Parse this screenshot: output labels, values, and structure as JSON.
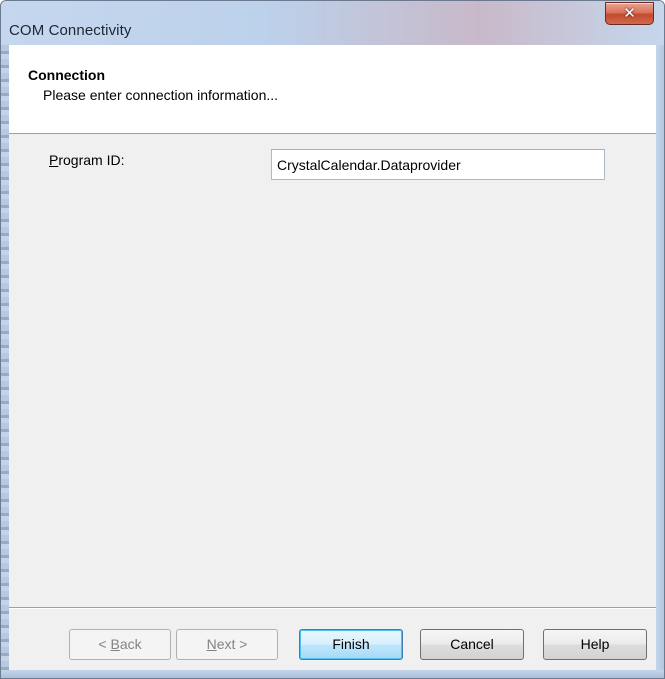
{
  "window": {
    "title": "COM Connectivity",
    "close_glyph": "✕"
  },
  "header": {
    "title": "Connection",
    "subtitle": "Please enter connection information..."
  },
  "form": {
    "program_id_label_mnemonic": "P",
    "program_id_label_rest": "rogram ID:",
    "program_id_value": "CrystalCalendar.Dataprovider"
  },
  "buttons": {
    "back_prefix": "< ",
    "back_mnemonic": "B",
    "back_rest": "ack",
    "next_mnemonic": "N",
    "next_rest": "ext >",
    "finish": "Finish",
    "cancel": "Cancel",
    "help": "Help"
  }
}
